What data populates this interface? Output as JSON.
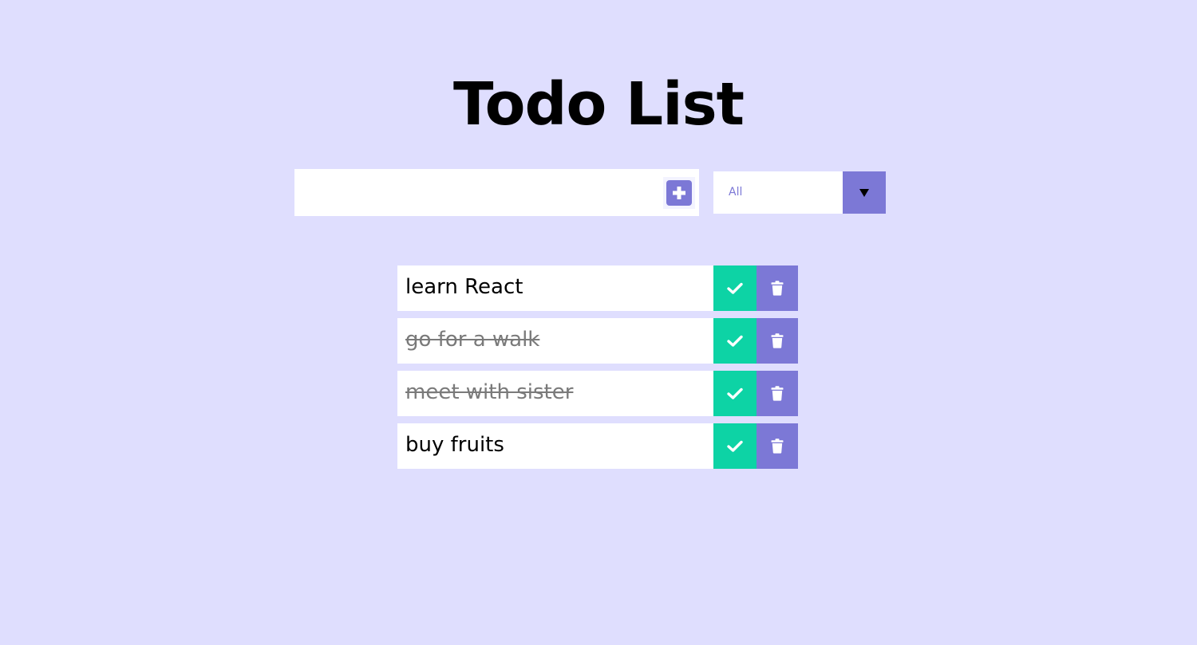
{
  "header": {
    "title": "Todo List"
  },
  "form": {
    "input_value": "",
    "add_icon": "plus-square-icon",
    "filter": {
      "selected": "All",
      "arrow_icon": "triangle-down-icon"
    }
  },
  "todos": [
    {
      "text": "learn React",
      "completed": false
    },
    {
      "text": "go for a walk",
      "completed": true
    },
    {
      "text": "meet with sister",
      "completed": true
    },
    {
      "text": "buy fruits",
      "completed": false
    }
  ],
  "icons": {
    "complete": "check-icon",
    "delete": "trash-icon"
  },
  "colors": {
    "background": "#dfdefe",
    "accent": "#7c78d6",
    "complete": "#0dd3a5",
    "completed_text": "#7a7a7a"
  }
}
